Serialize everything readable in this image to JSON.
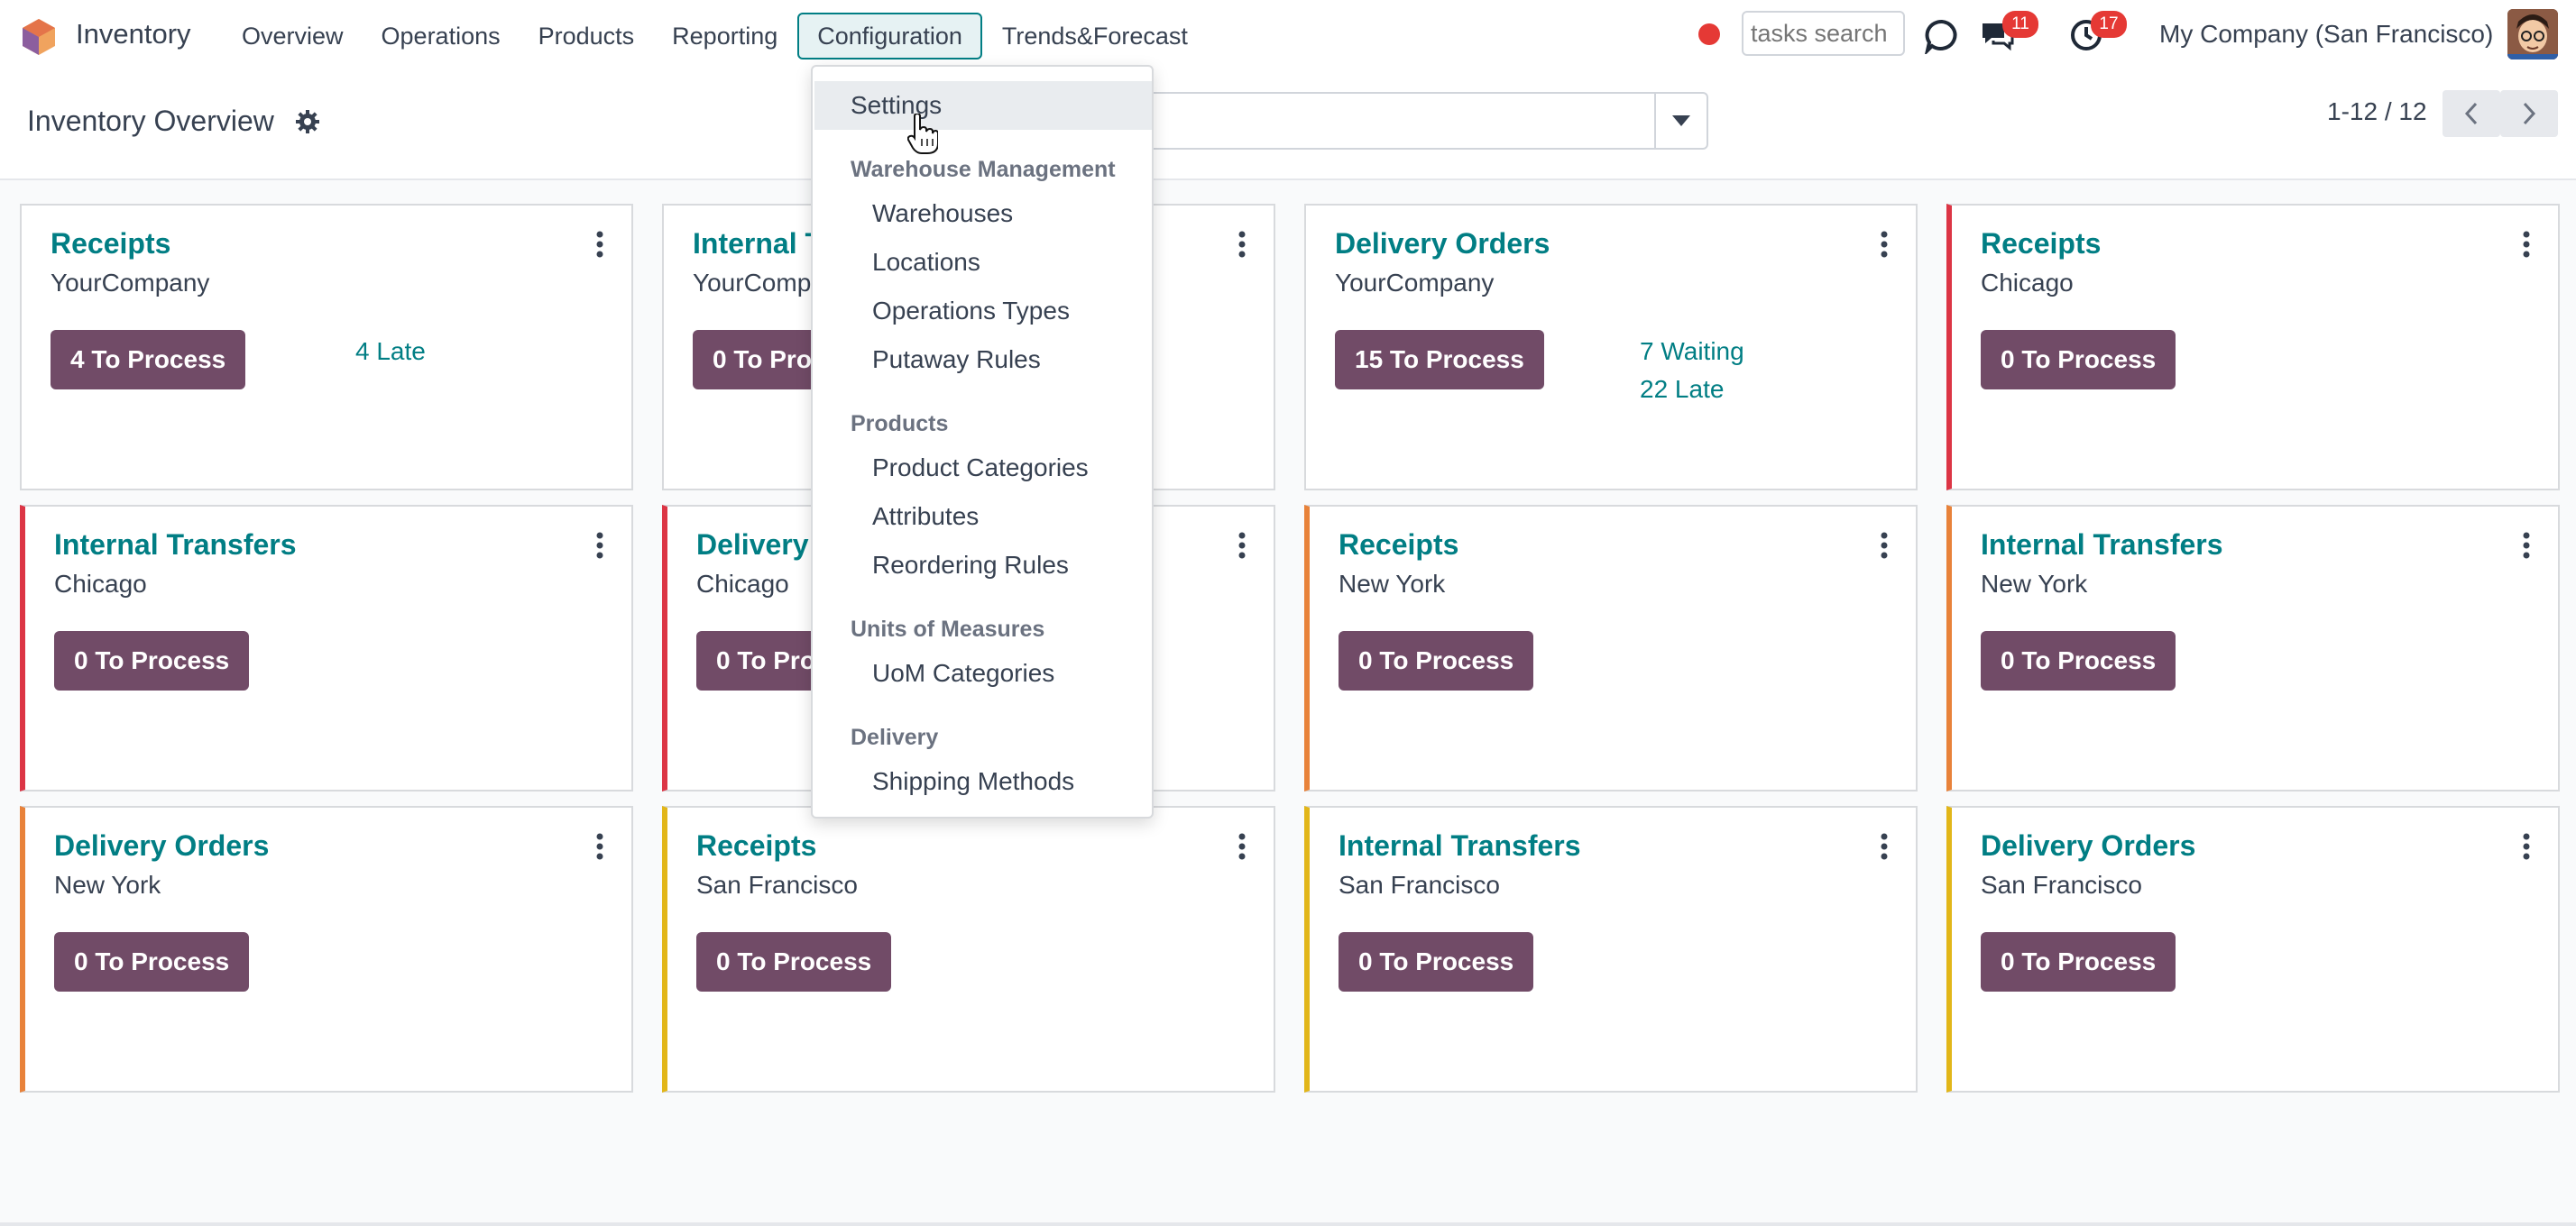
{
  "navbar": {
    "app_name": "Inventory",
    "menu": [
      {
        "label": "Overview"
      },
      {
        "label": "Operations"
      },
      {
        "label": "Products"
      },
      {
        "label": "Reporting"
      },
      {
        "label": "Configuration",
        "active": true
      },
      {
        "label": "Trends&Forecast"
      }
    ],
    "tasks_search_placeholder": "tasks search",
    "messages_count": "11",
    "activities_count": "17",
    "company": "My Company (San Francisco)"
  },
  "control_panel": {
    "title": "Inventory Overview",
    "pager": "1-12 / 12"
  },
  "cards": [
    {
      "title": "Receipts",
      "sub": "YourCompany",
      "button": "4 To Process",
      "stats": [
        "4 Late"
      ]
    },
    {
      "title": "Internal Transfers",
      "sub": "YourCompany",
      "button": "0 To Process",
      "stats": []
    },
    {
      "title": "Delivery Orders",
      "sub": "YourCompany",
      "button": "15 To Process",
      "stats": [
        "7 Waiting",
        "22 Late"
      ]
    },
    {
      "title": "Receipts",
      "sub": "Chicago",
      "button": "0 To Process",
      "stats": []
    },
    {
      "title": "Internal Transfers",
      "sub": "Chicago",
      "button": "0 To Process",
      "stats": []
    },
    {
      "title": "Delivery Orders",
      "sub": "Chicago",
      "button": "0 To Process",
      "stats": []
    },
    {
      "title": "Receipts",
      "sub": "New York",
      "button": "0 To Process",
      "stats": []
    },
    {
      "title": "Internal Transfers",
      "sub": "New York",
      "button": "0 To Process",
      "stats": []
    },
    {
      "title": "Delivery Orders",
      "sub": "New York",
      "button": "0 To Process",
      "stats": []
    },
    {
      "title": "Receipts",
      "sub": "San Francisco",
      "button": "0 To Process",
      "stats": []
    },
    {
      "title": "Internal Transfers",
      "sub": "San Francisco",
      "button": "0 To Process",
      "stats": []
    },
    {
      "title": "Delivery Orders",
      "sub": "San Francisco",
      "button": "0 To Process",
      "stats": []
    }
  ],
  "dropdown": {
    "settings": "Settings",
    "warehouse_header": "Warehouse Management",
    "warehouses": "Warehouses",
    "locations": "Locations",
    "operations_types": "Operations Types",
    "putaway_rules": "Putaway Rules",
    "products_header": "Products",
    "product_categories": "Product Categories",
    "attributes": "Attributes",
    "reordering_rules": "Reordering Rules",
    "uom_header": "Units of Measures",
    "uom_categories": "UoM Categories",
    "delivery_header": "Delivery",
    "shipping_methods": "Shipping Methods"
  },
  "colors": {
    "accent": "#017e84",
    "button": "#714b67",
    "badge": "#e53935",
    "late_red": "#dc3545",
    "warn_orange": "#e8823a",
    "warn_yellow": "#e2b619"
  }
}
